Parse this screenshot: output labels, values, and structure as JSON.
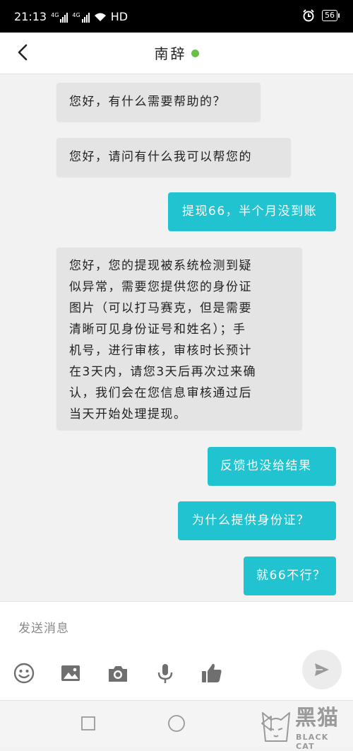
{
  "status_bar": {
    "time": "21:13",
    "network": "4G",
    "hd": "HD",
    "battery": "56"
  },
  "header": {
    "title": "南辞",
    "online_color": "#6cc04a"
  },
  "messages": [
    {
      "side": "in",
      "text": "您好，有什么需要帮助的？"
    },
    {
      "side": "in",
      "text": "您好，请问有什么我可以帮您的"
    },
    {
      "side": "out",
      "text": "提现66，半个月没到账"
    },
    {
      "side": "in",
      "lines": [
        "您好，您的提现被系统检测到疑",
        "似异常，需要您提供您的身份证",
        "图片（可以打马赛克，但是需要",
        "清晰可见身份证号和姓名）；手",
        "机号，进行审核，审核时长预计",
        "在3天内，请您3天后再次过来确",
        "认，我们会在您信息审核通过后",
        "当天开始处理提现。"
      ]
    },
    {
      "side": "out",
      "text": "反馈也没给结果"
    },
    {
      "side": "out",
      "text": "为什么提供身份证？"
    },
    {
      "side": "out",
      "text": "就66不行？"
    }
  ],
  "composer": {
    "placeholder": "发送消息"
  },
  "toolbar": [
    "emoji-icon",
    "image-icon",
    "camera-icon",
    "microphone-icon",
    "thumbs-up-icon"
  ],
  "colors": {
    "outgoing": "#22c3d0",
    "incoming": "#e4e4e4"
  },
  "watermark": {
    "brand": "黑猫",
    "brand_en": "BLACK CAT"
  }
}
